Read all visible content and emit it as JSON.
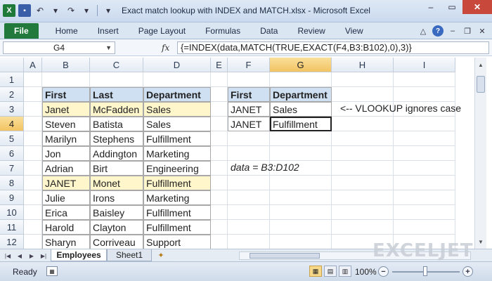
{
  "window": {
    "title": "Exact match lookup with INDEX and MATCH.xlsx - Microsoft Excel"
  },
  "ribbon": {
    "tabs": [
      "File",
      "Home",
      "Insert",
      "Page Layout",
      "Formulas",
      "Data",
      "Review",
      "View"
    ]
  },
  "formula_bar": {
    "name_box": "G4",
    "fx_label": "fx",
    "formula": "{=INDEX(data,MATCH(TRUE,EXACT(F4,B3:B102),0),3)}"
  },
  "grid": {
    "columns": [
      "A",
      "B",
      "C",
      "D",
      "E",
      "F",
      "G",
      "H",
      "I"
    ],
    "selected_column": "G",
    "rows": [
      "1",
      "2",
      "3",
      "4",
      "5",
      "6",
      "7",
      "8",
      "9",
      "10",
      "11",
      "12"
    ],
    "selected_row": "4",
    "table_headers": [
      "First",
      "Last",
      "Department"
    ],
    "employees": [
      [
        "Janet",
        "McFadden",
        "Sales"
      ],
      [
        "Steven",
        "Batista",
        "Sales"
      ],
      [
        "Marilyn",
        "Stephens",
        "Fulfillment"
      ],
      [
        "Jon",
        "Addington",
        "Marketing"
      ],
      [
        "Adrian",
        "Birt",
        "Engineering"
      ],
      [
        "JANET",
        "Monet",
        "Fulfillment"
      ],
      [
        "Julie",
        "Irons",
        "Marketing"
      ],
      [
        "Erica",
        "Baisley",
        "Fulfillment"
      ],
      [
        "Harold",
        "Clayton",
        "Fulfillment"
      ],
      [
        "Sharyn",
        "Corriveau",
        "Support"
      ]
    ],
    "lookup_headers": [
      "First",
      "Department"
    ],
    "lookup_rows": [
      [
        "JANET",
        "Sales"
      ],
      [
        "JANET",
        "Fulfillment"
      ]
    ],
    "note_vlookup": "<-- VLOOKUP ignores case",
    "note_data": "data = B3:D102"
  },
  "sheets": {
    "tabs": [
      "Employees",
      "Sheet1"
    ],
    "active": "Employees"
  },
  "watermark": "EXCELJET",
  "status_bar": {
    "ready": "Ready",
    "zoom": "100%"
  }
}
